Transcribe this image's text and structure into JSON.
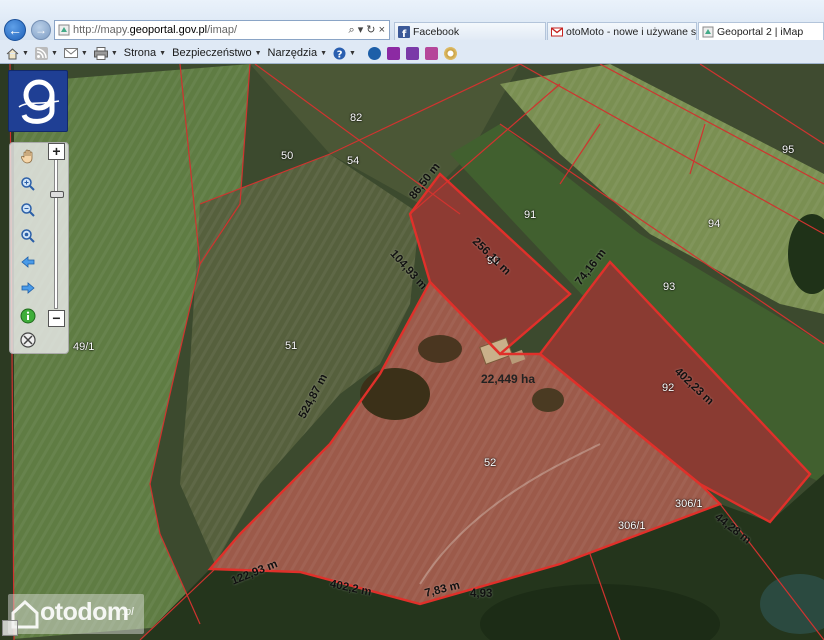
{
  "browser": {
    "address_prefix": "http://mapy.",
    "address_domain": "geoportal.gov.pl",
    "address_path": "/imap/",
    "address_tools": "⌕ ▾ ↻ ×",
    "tabs": [
      {
        "label": "Facebook",
        "active": false,
        "icon": "facebook-icon",
        "color": "#3b5998"
      },
      {
        "label": "otoMoto - nowe i używane sa...",
        "active": false,
        "icon": "gmail-icon",
        "color": "#c5221f"
      },
      {
        "label": "Geoportal 2 | iMap",
        "active": true,
        "icon": "geoportal-icon",
        "color": "#666666"
      }
    ],
    "commands": {
      "strona": "Strona",
      "bezpieczenstwo": "Bezpieczeństwo",
      "narzedzia": "Narzędzia"
    }
  },
  "map": {
    "highlight_color": "#c0392b",
    "parcel_line_color": "#d0332f",
    "parcel_numbers": [
      {
        "id": "p82",
        "label": "82"
      },
      {
        "id": "p50",
        "label": "50"
      },
      {
        "id": "p54",
        "label": "54"
      },
      {
        "id": "p95",
        "label": "95"
      },
      {
        "id": "p91",
        "label": "91"
      },
      {
        "id": "p94",
        "label": "94"
      },
      {
        "id": "p90",
        "label": "90"
      },
      {
        "id": "p93",
        "label": "93"
      },
      {
        "id": "p491",
        "label": "49/1"
      },
      {
        "id": "p51",
        "label": "51"
      },
      {
        "id": "p92",
        "label": "92"
      },
      {
        "id": "p52",
        "label": "52"
      },
      {
        "id": "p3064",
        "label": "306/1"
      },
      {
        "id": "p3065",
        "label": "306/1"
      }
    ],
    "measurements": [
      {
        "id": "m1",
        "label": "86,50 m"
      },
      {
        "id": "m2",
        "label": "256,11 m"
      },
      {
        "id": "m3",
        "label": "104,93 m"
      },
      {
        "id": "m4",
        "label": "74,16 m"
      },
      {
        "id": "m5",
        "label": "402,23 m"
      },
      {
        "id": "m6",
        "label": "524,87 m"
      },
      {
        "id": "m7",
        "label": "122,93 m"
      },
      {
        "id": "m8",
        "label": "402,2 m"
      },
      {
        "id": "m9",
        "label": "7,83 m"
      },
      {
        "id": "m10",
        "label": "4,93"
      },
      {
        "id": "m11",
        "label": "44,28 m"
      }
    ],
    "area_label": "22,449 ha"
  },
  "controls": {
    "logo_letter": "g",
    "zoom_plus": "+",
    "zoom_minus": "−",
    "zoom_level": 0.78
  },
  "watermark": {
    "brand": "otodom",
    "tld": ".pl"
  }
}
